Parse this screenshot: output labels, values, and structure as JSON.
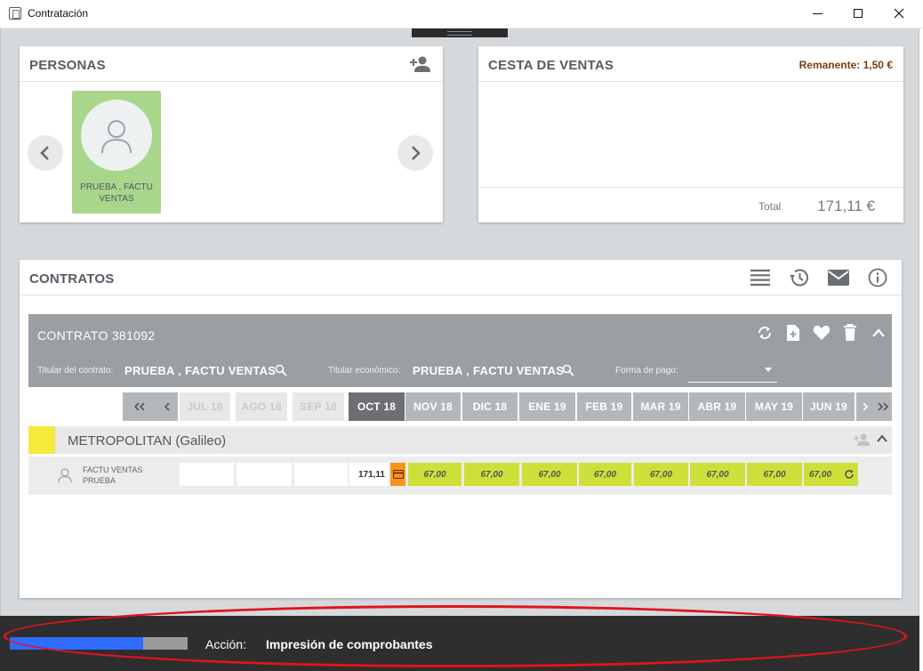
{
  "window": {
    "title": "Contratación"
  },
  "colors": {
    "accent_progress": "#2f6bff",
    "paid_cell": "#cde03a",
    "person_card": "#a8d68a",
    "line_color": "#f5e93c",
    "remanente": "#7a3e10",
    "annotation": "#e0141e"
  },
  "personas": {
    "title": "PERSONAS",
    "add_icon": "person-add-icon",
    "person": {
      "name_line1": "PRUEBA , FACTU",
      "name_line2": "VENTAS"
    }
  },
  "cesta": {
    "title": "CESTA DE VENTAS",
    "remanente": "Remanente: 1,50 €",
    "total_label": "Total",
    "total_value": "171,11 €"
  },
  "contratos": {
    "title": "CONTRATOS",
    "icons": [
      "list-icon",
      "history-icon",
      "mail-icon",
      "info-icon"
    ],
    "contract": {
      "title": "CONTRATO 381092",
      "titular_label": "Titular del contrato:",
      "titular_value": "PRUEBA , FACTU VENTAS",
      "economico_label": "Titular económico:",
      "economico_value": "PRUEBA , FACTU VENTAS",
      "pago_label": "Forma de pago:",
      "pago_value": ""
    },
    "months": {
      "past": [
        "JUL 18",
        "AGO 18",
        "SEP 18"
      ],
      "current": "OCT 18",
      "future": [
        "NOV 18",
        "DIC 18",
        "ENE 19",
        "FEB 19",
        "MAR 19",
        "ABR 19",
        "MAY 19",
        "JUN 19"
      ]
    },
    "line": {
      "name": "METROPOLITAN (Galileo)"
    },
    "person_row": {
      "name_line1": "FACTU VENTAS",
      "name_line2": "PRUEBA",
      "amount": "171,11",
      "payments": [
        "67,00",
        "67,00",
        "67,00",
        "67,00",
        "67,00",
        "67,00",
        "67,00",
        "67,00"
      ]
    }
  },
  "status": {
    "progress_fraction": 0.75,
    "accion_label": "Acción:",
    "accion_value": "Impresión de comprobantes"
  }
}
